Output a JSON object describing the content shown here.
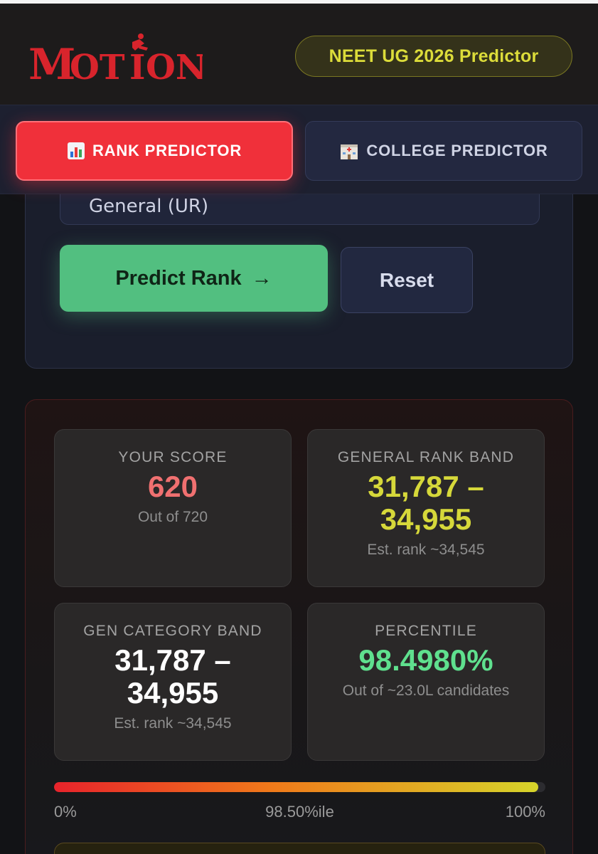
{
  "header": {
    "logo_text": "MOTION",
    "predictor_pill": "NEET UG 2026 Predictor"
  },
  "tabs": [
    {
      "icon": "bar-chart-icon",
      "label": "RANK PREDICTOR",
      "active": true
    },
    {
      "icon": "hospital-icon",
      "label": "COLLEGE PREDICTOR",
      "active": false
    }
  ],
  "form": {
    "category_value": "General (UR)",
    "predict_button": "Predict Rank",
    "predict_arrow": "→",
    "reset_button": "Reset"
  },
  "results": {
    "your_score": {
      "label": "YOUR SCORE",
      "value": "620",
      "sub": "Out of 720"
    },
    "general_rank_band": {
      "label": "GENERAL RANK BAND",
      "value_line1": "31,787 –",
      "value_line2": "34,955",
      "sub": "Est. rank ~34,545"
    },
    "gen_category_band": {
      "label": "GEN CATEGORY BAND",
      "value_line1": "31,787 –",
      "value_line2": "34,955",
      "sub": "Est. rank ~34,545"
    },
    "percentile": {
      "label": "PERCENTILE",
      "value": "98.4980%",
      "sub": "Out of ~23.0L candidates"
    },
    "progress": {
      "fraction": 0.985,
      "min_label": "0%",
      "value_label": "98.50%ile",
      "max_label": "100%"
    }
  },
  "colors": {
    "accent_red": "#f0303a",
    "score_red": "#f07070",
    "rank_yellow": "#d6d83a",
    "percentile_green": "#5fe08e",
    "predict_green": "#52bf80"
  }
}
